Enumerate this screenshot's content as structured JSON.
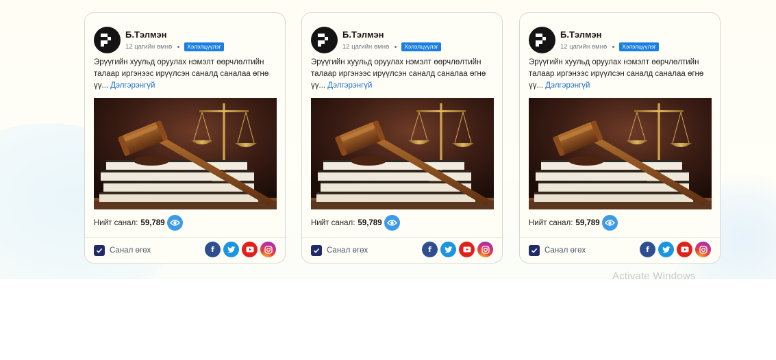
{
  "cards": [
    {
      "author": "Б.Тэлмэн",
      "time": "12 цагийн өмнө",
      "tag": "Хэлэлцүүлэг",
      "text": "Эрүүгийн хуульд оруулах нэмэлт өөрчлөлтийн талаар иргэнээс ирүүлсэн саналд саналаа өгнө үү...",
      "more": "Дэлгэрэнгүй",
      "image": "gavel-scales-books-photo",
      "votes_label": "Нийт санал:",
      "votes_count": "59,789",
      "vote_button": "Санал өгөх"
    },
    {
      "author": "Б.Тэлмэн",
      "time": "12 цагийн өмнө",
      "tag": "Хэлэлцүүлэг",
      "text": "Эрүүгийн хуульд оруулах нэмэлт өөрчлөлтийн талаар иргэнээс ирүүлсэн саналд саналаа өгнө үү...",
      "more": "Дэлгэрэнгүй",
      "image": "gavel-scales-books-photo",
      "votes_label": "Нийт санал:",
      "votes_count": "59,789",
      "vote_button": "Санал өгөх"
    },
    {
      "author": "Б.Тэлмэн",
      "time": "12 цагийн өмнө",
      "tag": "Хэлэлцүүлэг",
      "text": "Эрүүгийн хуульд оруулах нэмэлт өөрчлөлтийн талаар иргэнээс ирүүлсэн саналд саналаа өгнө үү...",
      "more": "Дэлгэрэнгүй",
      "image": "gavel-scales-books-photo",
      "votes_label": "Нийт санал:",
      "votes_count": "59,789",
      "vote_button": "Санал өгөх"
    }
  ],
  "social_icons": [
    "facebook-icon",
    "twitter-icon",
    "youtube-icon",
    "instagram-icon"
  ],
  "colors": {
    "tag_bg": "#1a7fe0",
    "link": "#1a6fd0",
    "eye_bg": "#3d9ae8",
    "checkbox": "#1f2a66",
    "facebook": "#2f4e8f",
    "twitter": "#1a95e0",
    "youtube": "#e0201b"
  },
  "watermark": "Activate Windows"
}
